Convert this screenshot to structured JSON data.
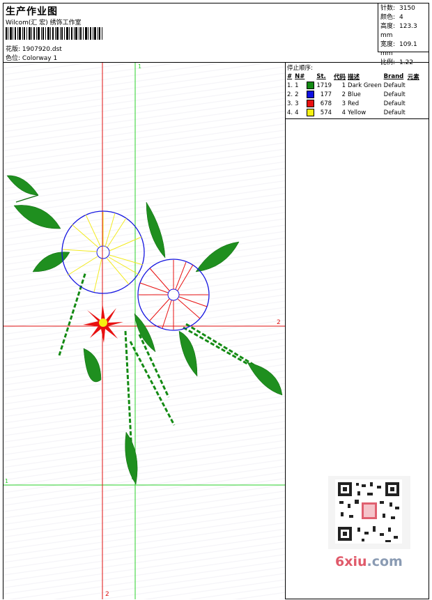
{
  "header": {
    "title": "生产作业图",
    "company": "Wilcom(汇 宏) 绣饰工作室",
    "design_label": "花版:",
    "design_file": "1907920.dst",
    "color_label": "色位:",
    "colorway": "Colorway 1"
  },
  "stats": [
    {
      "label": "针数:",
      "value": "3150"
    },
    {
      "label": "颜色:",
      "value": "4"
    },
    {
      "label": "高度:",
      "value": "123.3 mm"
    },
    {
      "label": "宽度:",
      "value": "109.1 mm"
    },
    {
      "label": "比例:",
      "value": "1.22"
    }
  ],
  "stop_sequence": {
    "title": "停止顺序:",
    "headers": [
      "#",
      "N#",
      "St.",
      "代码",
      "描述",
      "Brand",
      "元素"
    ],
    "rows": [
      {
        "idx": "1.",
        "n": "1",
        "color": "#138a13",
        "st": "1719",
        "code": "1",
        "desc": "Dark Green",
        "brand": "Default"
      },
      {
        "idx": "2.",
        "n": "2",
        "color": "#0f10e0",
        "st": "177",
        "code": "2",
        "desc": "Blue",
        "brand": "Default"
      },
      {
        "idx": "3.",
        "n": "3",
        "color": "#e81010",
        "st": "678",
        "code": "3",
        "desc": "Red",
        "brand": "Default"
      },
      {
        "idx": "4.",
        "n": "4",
        "color": "#f5f010",
        "st": "574",
        "code": "4",
        "desc": "Yellow",
        "brand": "Default"
      }
    ]
  },
  "guides": {
    "green_top": "1",
    "red_right": "2",
    "green_left": "1",
    "red_bottom": "2"
  },
  "watermark": {
    "brand_a": "6xiu",
    "brand_b": ".com"
  }
}
